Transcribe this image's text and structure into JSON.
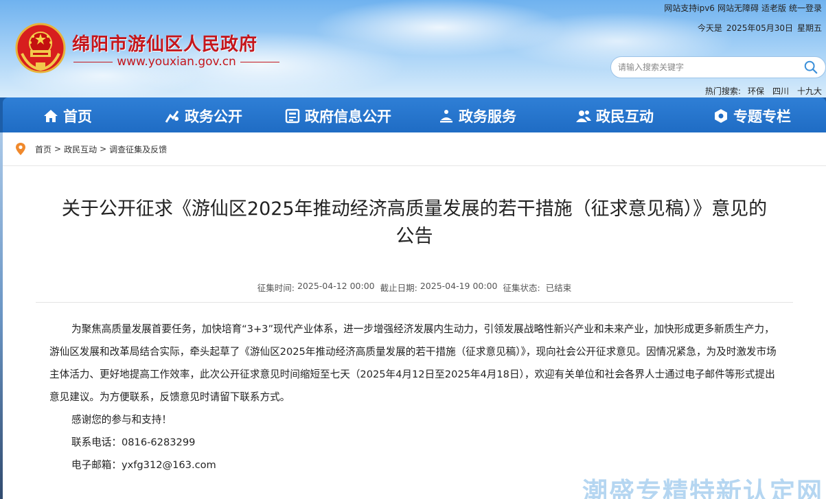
{
  "header": {
    "site_title": "绵阳市游仙区人民政府",
    "site_url": "www.youxian.gov.cn",
    "top_links": [
      "网站支持ipv6",
      "网站无障碍",
      "适老版",
      "统一登录"
    ],
    "date_prefix": "今天是",
    "date": "2025年05月30日",
    "weekday": "星期五",
    "search_placeholder": "请输入搜索关键字",
    "hot_label": "热门搜索:",
    "hot_words": [
      "环保",
      "四川",
      "十九大"
    ]
  },
  "nav": {
    "items": [
      {
        "label": "首页",
        "icon": "home-icon"
      },
      {
        "label": "政务公开",
        "icon": "chart-icon"
      },
      {
        "label": "政府信息公开",
        "icon": "document-icon"
      },
      {
        "label": "政务服务",
        "icon": "service-icon"
      },
      {
        "label": "政民互动",
        "icon": "users-icon"
      },
      {
        "label": "专题专栏",
        "icon": "topic-icon"
      }
    ]
  },
  "breadcrumb": {
    "icon": "location-pin-icon",
    "items": [
      "首页",
      "政民互动",
      "调查征集及反馈"
    ],
    "separator": ">"
  },
  "article": {
    "title_line1": "关于公开征求《游仙区2025年推动经济高质量发展的若干措施（征求意见稿）》意见的",
    "title_line2": "公告",
    "meta": {
      "start_label": "征集时间:",
      "start": "2025-04-12 00:00",
      "end_label": "截止日期:",
      "end": "2025-04-19 00:00",
      "status_label": "征集状态:",
      "status": "已结束"
    },
    "paragraph1": "为聚焦高质量发展首要任务，加快培育“3+3”现代产业体系，进一步增强经济发展内生动力，引领发展战略性新兴产业和未来产业，加快形成更多新质生产力，游仙区发展和改革局结合实际，牵头起草了《游仙区2025年推动经济高质量发展的若干措施（征求意见稿）》，现向社会公开征求意见。因情况紧急，为及时激发市场主体活力、更好地提高工作效率，此次公开征求意见时间缩短至七天（2025年4月12日至2025年4月18日），欢迎有关单位和社会各界人士通过电子邮件等形式提出意见建议。为方便联系，反馈意见时请留下联系方式。",
    "thanks": "感谢您的参与和支持！",
    "phone_label": "联系电话：",
    "phone": "0816-6283299",
    "email_label": "电子邮箱：",
    "email": "yxfg312@163.com"
  },
  "watermark": "潮盛专精特新认定网",
  "colors": {
    "brand_red": "#c4161c",
    "nav_blue": "#1f6cc4"
  }
}
